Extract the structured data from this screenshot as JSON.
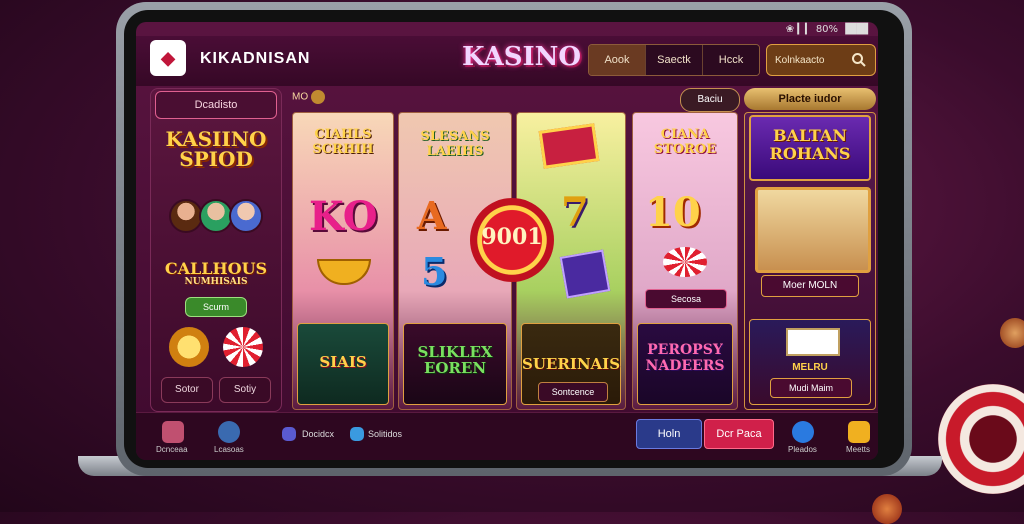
{
  "statusbar": {
    "text": "❀ ▎▎ 80% ▐██▌"
  },
  "header": {
    "brand": "KIKADNISAN",
    "center_logo": "KASINO",
    "nav": [
      "Aook",
      "Saectk",
      "Hcck"
    ],
    "search_label": "Kolnkaacto"
  },
  "promo": {
    "tag": "Dcadisto",
    "title": "KASIINO SPIOD",
    "label": "CALLHOUS",
    "sublabel": "NUMHISAIS",
    "button": "Scurm",
    "btn_left": "Sotor",
    "btn_right": "Sotiy"
  },
  "reels": {
    "counter": "MO",
    "filter_pill": "Baciu",
    "filter_button": "Placte iudor"
  },
  "tiles": {
    "col1": {
      "title": "CIAHLS SCRHIH",
      "sym": "KO",
      "bottom": "SIAIS"
    },
    "col2": {
      "title": "SLESANS LAEIHS",
      "sym_a": "A",
      "sym_b": "5",
      "bottom": "SLIKLEX EOREN"
    },
    "col3": {
      "sym": "7",
      "chip": "9001",
      "bottom": "SUERINAIS",
      "bottom_btn": "Sontcence"
    },
    "col4": {
      "title": "CIANA STOROE",
      "sym": "10",
      "btn": "Secosa",
      "bottom": "PEROPSY NADEERS"
    },
    "col5": {
      "title": "BALTAN ROHANS",
      "btn": "Moer MOLN",
      "bottom_btn": "Mudi Maim",
      "bottom_label": "MELRU"
    }
  },
  "bottombar": {
    "icon1": "Dcnceaa",
    "icon2": "Lcasoas",
    "link1": "Docidcx",
    "link2": "Solitidos",
    "btn_home": "Holn",
    "btn_place": "Dcr Paca",
    "icon3": "Pleados",
    "icon4": "Meetts"
  },
  "colors": {
    "accent": "#ffd24a",
    "brand": "#c0163a",
    "button_red": "#d0204a",
    "button_blue": "#2a3a8a"
  }
}
